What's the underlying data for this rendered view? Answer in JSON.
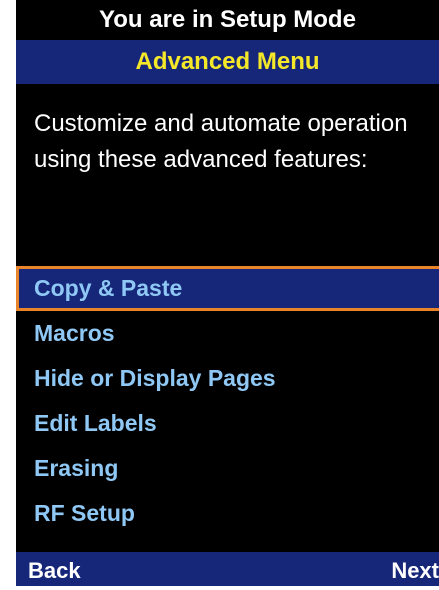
{
  "header": {
    "mode_text": "You are in Setup Mode",
    "menu_title": "Advanced Menu"
  },
  "description": "Customize and automate operation using these advanced features:",
  "menu": {
    "selected_index": 0,
    "items": [
      {
        "label": "Copy & Paste"
      },
      {
        "label": "Macros"
      },
      {
        "label": "Hide or Display Pages"
      },
      {
        "label": "Edit Labels"
      },
      {
        "label": "Erasing"
      },
      {
        "label": "RF Setup"
      }
    ]
  },
  "softkeys": {
    "left_label": "Back",
    "right_label": "Next"
  },
  "colors": {
    "background": "#000000",
    "header_bar": "#16277a",
    "title_text": "#f5e829",
    "menu_text": "#8fc8f5",
    "selection_border": "#e8842a"
  }
}
